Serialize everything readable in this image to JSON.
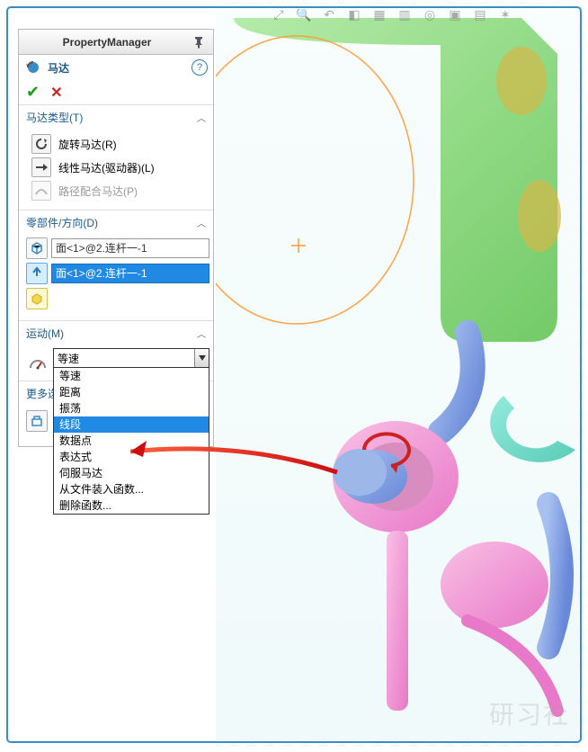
{
  "pm": {
    "title": "PropertyManager"
  },
  "feature": {
    "name": "马达"
  },
  "sections": {
    "type": {
      "title": "马达类型(T)",
      "rotary": "旋转马达(R)",
      "linear": "线性马达(驱动器)(L)",
      "path": "路径配合马达(P)"
    },
    "component": {
      "title": "零部件/方向(D)",
      "face": "面<1>@2.连杆一-1",
      "dir": "面<1>@2.连杆一-1"
    },
    "motion": {
      "title": "运动(M)",
      "selected": "等速",
      "options": [
        "等速",
        "距离",
        "振荡",
        "线段",
        "数据点",
        "表达式",
        "伺服马达",
        "从文件装入函数...",
        "删除函数..."
      ],
      "highlight_index": 3
    },
    "more": {
      "title": "更多选项(O)..."
    }
  },
  "watermark": "研习社"
}
